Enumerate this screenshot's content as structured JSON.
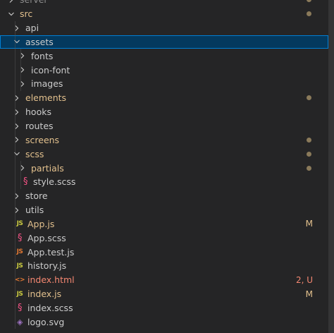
{
  "explorer": {
    "items": [
      {
        "label": "server",
        "kind": "folder",
        "depth": 0,
        "expanded": false,
        "status": "faded",
        "dot": true
      },
      {
        "label": "src",
        "kind": "folder",
        "depth": 0,
        "expanded": true,
        "status": "modified",
        "dot": true
      },
      {
        "label": "api",
        "kind": "folder",
        "depth": 1,
        "expanded": false,
        "status": "normal"
      },
      {
        "label": "assets",
        "kind": "folder",
        "depth": 1,
        "expanded": true,
        "status": "normal",
        "selected": true
      },
      {
        "label": "fonts",
        "kind": "folder",
        "depth": 2,
        "expanded": false,
        "status": "normal"
      },
      {
        "label": "icon-font",
        "kind": "folder",
        "depth": 2,
        "expanded": false,
        "status": "normal"
      },
      {
        "label": "images",
        "kind": "folder",
        "depth": 2,
        "expanded": false,
        "status": "normal"
      },
      {
        "label": "elements",
        "kind": "folder",
        "depth": 1,
        "expanded": false,
        "status": "modified",
        "dot": true
      },
      {
        "label": "hooks",
        "kind": "folder",
        "depth": 1,
        "expanded": false,
        "status": "normal"
      },
      {
        "label": "routes",
        "kind": "folder",
        "depth": 1,
        "expanded": false,
        "status": "normal"
      },
      {
        "label": "screens",
        "kind": "folder",
        "depth": 1,
        "expanded": false,
        "status": "modified",
        "dot": true
      },
      {
        "label": "scss",
        "kind": "folder",
        "depth": 1,
        "expanded": true,
        "status": "modified",
        "dot": true
      },
      {
        "label": "partials",
        "kind": "folder",
        "depth": 2,
        "expanded": false,
        "status": "modified",
        "dot": true
      },
      {
        "label": "style.scss",
        "kind": "file",
        "icon": "scss-icon",
        "depth": 2,
        "status": "normal"
      },
      {
        "label": "store",
        "kind": "folder",
        "depth": 1,
        "expanded": false,
        "status": "normal"
      },
      {
        "label": "utils",
        "kind": "folder",
        "depth": 1,
        "expanded": false,
        "status": "normal"
      },
      {
        "label": "App.js",
        "kind": "file",
        "icon": "js-icon",
        "depth": 1,
        "status": "modified",
        "badge": "M"
      },
      {
        "label": "App.scss",
        "kind": "file",
        "icon": "scss-icon",
        "depth": 1,
        "status": "normal"
      },
      {
        "label": "App.test.js",
        "kind": "file",
        "icon": "js-test-icon",
        "depth": 1,
        "status": "normal"
      },
      {
        "label": "history.js",
        "kind": "file",
        "icon": "js-icon",
        "depth": 1,
        "status": "normal"
      },
      {
        "label": "index.html",
        "kind": "file",
        "icon": "html-icon",
        "depth": 1,
        "status": "error",
        "badge": "2, U"
      },
      {
        "label": "index.js",
        "kind": "file",
        "icon": "js-icon",
        "depth": 1,
        "status": "modified",
        "badge": "M"
      },
      {
        "label": "index.scss",
        "kind": "file",
        "icon": "scss-icon",
        "depth": 1,
        "status": "normal"
      },
      {
        "label": "logo.svg",
        "kind": "file",
        "icon": "svg-icon",
        "depth": 1,
        "status": "normal"
      }
    ]
  },
  "icons": {
    "js-icon": {
      "glyph": "JS",
      "color": "#cbcb41"
    },
    "js-test-icon": {
      "glyph": "JS",
      "color": "#e37933"
    },
    "scss-icon": {
      "glyph": "§",
      "color": "#f55385"
    },
    "html-icon": {
      "glyph": "<>",
      "color": "#e37933"
    },
    "svg-icon": {
      "glyph": "◈",
      "color": "#a074c4"
    }
  },
  "colors": {
    "background": "#252526",
    "selected_bg": "#04395e",
    "selected_border": "#007fd4",
    "modified": "#e2c08d",
    "error": "#f48771",
    "text": "#cccccc",
    "dot": "#8a7a5a"
  }
}
